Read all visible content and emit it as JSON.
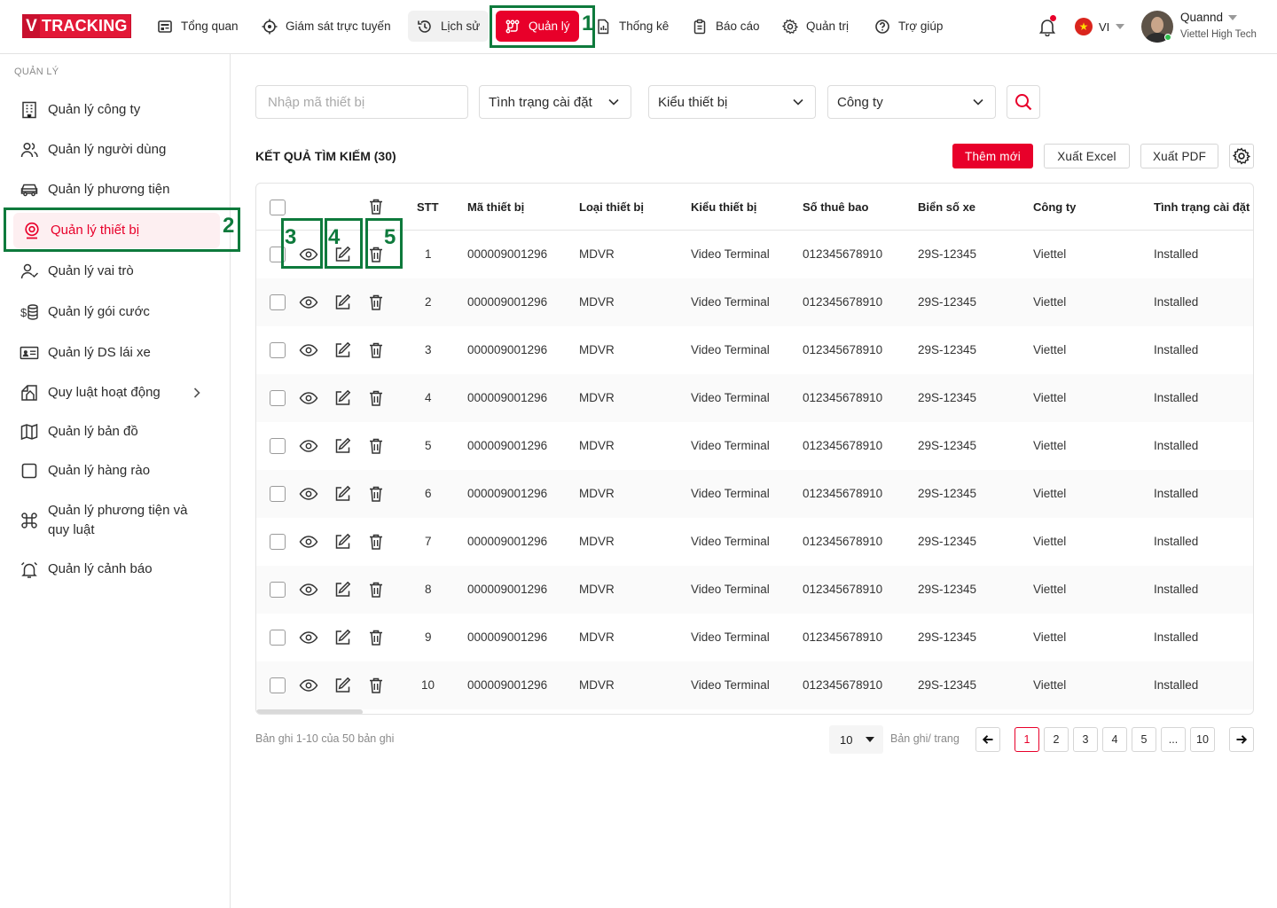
{
  "header": {
    "logo_v": "V",
    "logo_text": "TRACKING",
    "nav": [
      {
        "label": "Tổng quan",
        "icon": "dashboard-icon"
      },
      {
        "label": "Giám sát trực tuyến",
        "icon": "crosshair-icon"
      },
      {
        "label": "Lịch sử",
        "icon": "history-icon"
      },
      {
        "label": "Quản lý",
        "icon": "manage-nodes-icon",
        "active": true
      },
      {
        "label": "Thống kê",
        "icon": "file-chart-icon"
      },
      {
        "label": "Báo cáo",
        "icon": "clipboard-icon"
      },
      {
        "label": "Quản trị",
        "icon": "gear-icon"
      },
      {
        "label": "Trợ giúp",
        "icon": "help-circle-icon"
      }
    ],
    "language": "VI",
    "user": {
      "name": "Quannd",
      "org": "Viettel High Tech"
    }
  },
  "sidebar": {
    "section_title": "QUẢN LÝ",
    "items": [
      {
        "label": "Quản lý công ty",
        "icon": "building-icon"
      },
      {
        "label": "Quản lý người dùng",
        "icon": "users-icon"
      },
      {
        "label": "Quản lý phương tiện",
        "icon": "car-icon"
      },
      {
        "label": "Quản lý thiết bị",
        "icon": "location-device-icon",
        "active": true
      },
      {
        "label": "Quản lý vai trò",
        "icon": "user-check-icon"
      },
      {
        "label": "Quản lý gói cước",
        "icon": "coins-icon"
      },
      {
        "label": "Quản lý DS lái xe",
        "icon": "id-card-icon"
      },
      {
        "label": "Quy luật hoạt động",
        "icon": "rules-icon",
        "has_children": true
      },
      {
        "label": "Quản lý bản đồ",
        "icon": "map-icon"
      },
      {
        "label": "Quản lý hàng rào",
        "icon": "square-icon"
      },
      {
        "label": "Quản lý phương tiện và quy luật",
        "label_line1": "Quản lý phương tiện và",
        "label_line2": "quy luật",
        "icon": "command-icon"
      },
      {
        "label": "Quản lý cảnh báo",
        "icon": "alarm-icon"
      }
    ]
  },
  "filters": {
    "device_code_placeholder": "Nhập mã thiết bị",
    "install_status": "Tình trạng cài đặt",
    "device_type": "Kiểu thiết bị",
    "company": "Công ty"
  },
  "results": {
    "title": "KẾT QUẢ TÌM KIẾM (30)",
    "add_button": "Thêm mới",
    "export_excel": "Xuất Excel",
    "export_pdf": "Xuất PDF"
  },
  "table": {
    "columns": [
      "STT",
      "Mã thiết bị",
      "Loại thiết bị",
      "Kiểu thiết bị",
      "Số thuê bao",
      "Biển số xe",
      "Công ty",
      "Tình trạng cài đặt"
    ],
    "rows": [
      [
        "1",
        "000009001296",
        "MDVR",
        "Video Terminal",
        "012345678910",
        "29S-12345",
        "Viettel",
        "Installed"
      ],
      [
        "2",
        "000009001296",
        "MDVR",
        "Video Terminal",
        "012345678910",
        "29S-12345",
        "Viettel",
        "Installed"
      ],
      [
        "3",
        "000009001296",
        "MDVR",
        "Video Terminal",
        "012345678910",
        "29S-12345",
        "Viettel",
        "Installed"
      ],
      [
        "4",
        "000009001296",
        "MDVR",
        "Video Terminal",
        "012345678910",
        "29S-12345",
        "Viettel",
        "Installed"
      ],
      [
        "5",
        "000009001296",
        "MDVR",
        "Video Terminal",
        "012345678910",
        "29S-12345",
        "Viettel",
        "Installed"
      ],
      [
        "6",
        "000009001296",
        "MDVR",
        "Video Terminal",
        "012345678910",
        "29S-12345",
        "Viettel",
        "Installed"
      ],
      [
        "7",
        "000009001296",
        "MDVR",
        "Video Terminal",
        "012345678910",
        "29S-12345",
        "Viettel",
        "Installed"
      ],
      [
        "8",
        "000009001296",
        "MDVR",
        "Video Terminal",
        "012345678910",
        "29S-12345",
        "Viettel",
        "Installed"
      ],
      [
        "9",
        "000009001296",
        "MDVR",
        "Video Terminal",
        "012345678910",
        "29S-12345",
        "Viettel",
        "Installed"
      ],
      [
        "10",
        "000009001296",
        "MDVR",
        "Video Terminal",
        "012345678910",
        "29S-12345",
        "Viettel",
        "Installed"
      ]
    ]
  },
  "pagination": {
    "info": "Bản ghi 1-10 của 50 bản ghi",
    "page_size": "10",
    "per_page_label": "Bản ghi/ trang",
    "pages": [
      "1",
      "2",
      "3",
      "4",
      "5",
      "...",
      "10"
    ],
    "current": "1"
  },
  "annotations": [
    "1",
    "2",
    "3",
    "4",
    "5"
  ],
  "colors": {
    "accent": "#e8002a",
    "annotation": "#0e7a3c",
    "active_bg": "#fdeff1"
  }
}
